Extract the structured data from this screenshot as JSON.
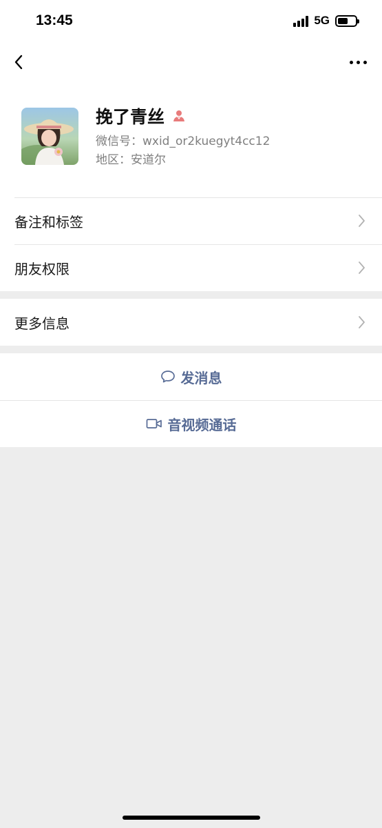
{
  "status_bar": {
    "time": "13:45",
    "network": "5G",
    "battery_level": 0.6
  },
  "nav": {
    "back_icon": "chevron-left-icon",
    "more_icon": "ellipsis-icon"
  },
  "profile": {
    "nickname": "挽了青丝",
    "gender_icon": "female-person-icon",
    "gender_color": "#e87b7b",
    "wxid": "微信号：wxid_or2kuegyt4cc12",
    "region": "地区：安道尔"
  },
  "menu": {
    "items": [
      {
        "label": "备注和标签"
      },
      {
        "label": "朋友权限"
      }
    ],
    "more": {
      "label": "更多信息"
    }
  },
  "actions": {
    "message": {
      "label": "发消息",
      "icon": "chat-bubble-icon"
    },
    "call": {
      "label": "音视频通话",
      "icon": "video-camera-icon"
    }
  },
  "colors": {
    "link": "#576b95",
    "background": "#ededed",
    "card": "#ffffff"
  }
}
